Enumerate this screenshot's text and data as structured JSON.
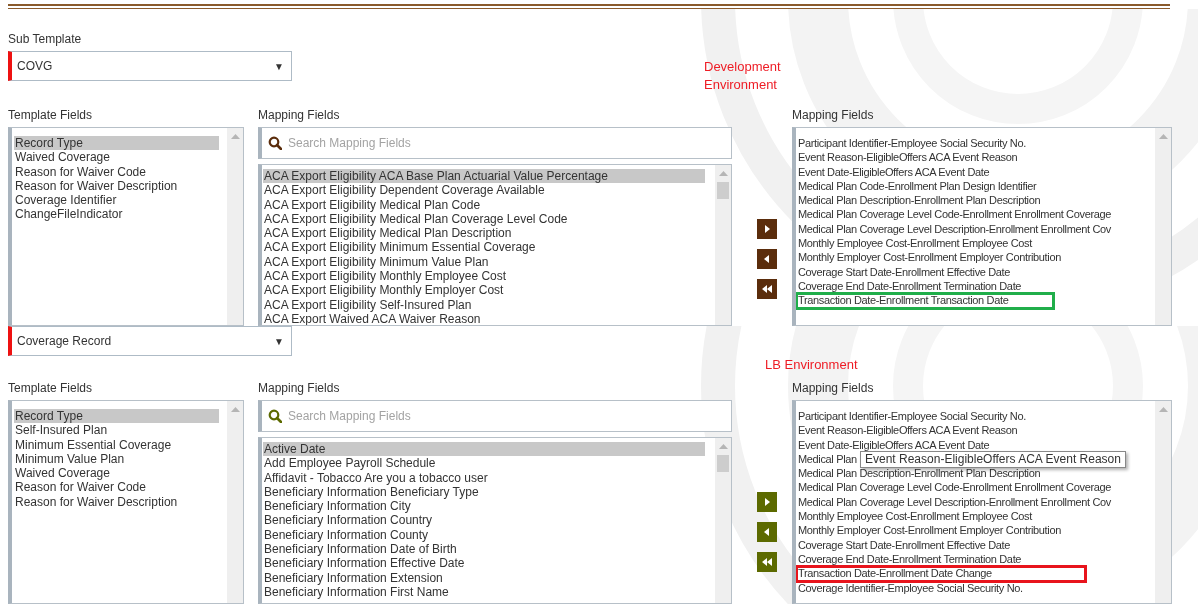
{
  "panels": [
    {
      "sub_template_label": "Sub Template",
      "dropdown": {
        "value": "COVG",
        "caret": "▼"
      },
      "environment_label": "Development Environment",
      "arrow_buttons": {
        "color": "#5b2d0c"
      },
      "highlight": {
        "color": "#20ae4a"
      },
      "template_fields": {
        "label": "Template Fields",
        "items": [
          {
            "text": "Record Type",
            "selected": true
          },
          {
            "text": "Waived Coverage",
            "selected": false
          },
          {
            "text": "Reason for Waiver Code",
            "selected": false
          },
          {
            "text": "Reason for Waiver Description",
            "selected": false
          },
          {
            "text": "Coverage Identifier",
            "selected": false
          },
          {
            "text": "ChangeFileIndicator",
            "selected": false
          }
        ]
      },
      "mapping_fields": {
        "label": "Mapping Fields",
        "search_placeholder": "Search Mapping Fields",
        "items": [
          {
            "text": "ACA Export Eligibility ACA Base Plan Actuarial Value Percentage",
            "selected": true
          },
          {
            "text": "ACA Export Eligibility Dependent Coverage Available",
            "selected": false
          },
          {
            "text": "ACA Export Eligibility Medical Plan Code",
            "selected": false
          },
          {
            "text": "ACA Export Eligibility Medical Plan Coverage Level Code",
            "selected": false
          },
          {
            "text": "ACA Export Eligibility Medical Plan Description",
            "selected": false
          },
          {
            "text": "ACA Export Eligibility Minimum Essential Coverage",
            "selected": false
          },
          {
            "text": "ACA Export Eligibility Minimum Value Plan",
            "selected": false
          },
          {
            "text": "ACA Export Eligibility Monthly Employee Cost",
            "selected": false
          },
          {
            "text": "ACA Export Eligibility Monthly Employer Cost",
            "selected": false
          },
          {
            "text": "ACA Export Eligibility Self-Insured Plan",
            "selected": false
          },
          {
            "text": "ACA Export Waived ACA Waiver Reason",
            "selected": false
          }
        ]
      },
      "mapped_fields": {
        "label": "Mapping Fields",
        "items": [
          {
            "text": "Participant Identifier-Employee Social Security No.",
            "highlighted": false
          },
          {
            "text": "Event Reason-EligibleOffers ACA Event Reason",
            "highlighted": false
          },
          {
            "text": "Event Date-EligibleOffers ACA Event Date",
            "highlighted": false
          },
          {
            "text": "Medical Plan Code-Enrollment Plan Design Identifier",
            "highlighted": false
          },
          {
            "text": "Medical Plan Description-Enrollment Plan Description",
            "highlighted": false
          },
          {
            "text": "Medical Plan Coverage Level Code-Enrollment Enrollment Coverage",
            "highlighted": false
          },
          {
            "text": "Medical Plan Coverage Level Description-Enrollment Enrollment Cov",
            "highlighted": false
          },
          {
            "text": "Monthly Employee Cost-Enrollment Employee Cost",
            "highlighted": false
          },
          {
            "text": "Monthly Employer Cost-Enrollment Employer Contribution",
            "highlighted": false
          },
          {
            "text": "Coverage Start Date-Enrollment Effective Date",
            "highlighted": false
          },
          {
            "text": "Coverage End Date-Enrollment Termination Date",
            "highlighted": false
          },
          {
            "text": "Transaction Date-Enrollment Transaction Date",
            "highlighted": true
          }
        ]
      }
    },
    {
      "dropdown": {
        "value": "Coverage Record",
        "caret": "▼"
      },
      "environment_label": "LB Environment",
      "arrow_buttons": {
        "color": "#5c6a00"
      },
      "highlight": {
        "color": "#e8141c"
      },
      "template_fields": {
        "label": "Template Fields",
        "items": [
          {
            "text": "Record Type",
            "selected": true
          },
          {
            "text": "Self-Insured Plan",
            "selected": false
          },
          {
            "text": "Minimum Essential Coverage",
            "selected": false
          },
          {
            "text": "Minimum Value Plan",
            "selected": false
          },
          {
            "text": "Waived Coverage",
            "selected": false
          },
          {
            "text": "Reason for Waiver Code",
            "selected": false
          },
          {
            "text": "Reason for Waiver Description",
            "selected": false
          }
        ]
      },
      "mapping_fields": {
        "label": "Mapping Fields",
        "search_placeholder": "Search Mapping Fields",
        "items": [
          {
            "text": "Active Date",
            "selected": true
          },
          {
            "text": "Add Employee Payroll Schedule",
            "selected": false
          },
          {
            "text": "Affidavit - Tobacco Are you a tobacco user",
            "selected": false
          },
          {
            "text": "Beneficiary Information Beneficiary Type",
            "selected": false
          },
          {
            "text": "Beneficiary Information City",
            "selected": false
          },
          {
            "text": "Beneficiary Information Country",
            "selected": false
          },
          {
            "text": "Beneficiary Information County",
            "selected": false
          },
          {
            "text": "Beneficiary Information Date of Birth",
            "selected": false
          },
          {
            "text": "Beneficiary Information Effective Date",
            "selected": false
          },
          {
            "text": "Beneficiary Information Extension",
            "selected": false
          },
          {
            "text": "Beneficiary Information First Name",
            "selected": false
          }
        ]
      },
      "mapped_fields": {
        "label": "Mapping Fields",
        "items": [
          {
            "text": "Participant Identifier-Employee Social Security No.",
            "highlighted": false
          },
          {
            "text": "Event Reason-EligibleOffers ACA Event Reason",
            "highlighted": false
          },
          {
            "text": "Event Date-EligibleOffers ACA Event Date",
            "highlighted": false
          },
          {
            "text": "Medical Plan",
            "highlighted": false,
            "tooltip": "Event Reason-EligibleOffers ACA Event Reason"
          },
          {
            "text": "Medical Plan Description-Enrollment Plan Description",
            "highlighted": false
          },
          {
            "text": "Medical Plan Coverage Level Code-Enrollment Enrollment Coverage",
            "highlighted": false
          },
          {
            "text": "Medical Plan Coverage Level Description-Enrollment Enrollment Cov",
            "highlighted": false
          },
          {
            "text": "Monthly Employee Cost-Enrollment Employee Cost",
            "highlighted": false
          },
          {
            "text": "Monthly Employer Cost-Enrollment Employer Contribution",
            "highlighted": false
          },
          {
            "text": "Coverage Start Date-Enrollment Effective Date",
            "highlighted": false
          },
          {
            "text": "Coverage End Date-Enrollment Termination Date",
            "highlighted": false
          },
          {
            "text": "Transaction Date-Enrollment Date Change",
            "highlighted": true
          },
          {
            "text": "Coverage Identifier-Employee Social Security No.",
            "highlighted": false
          }
        ]
      }
    }
  ]
}
